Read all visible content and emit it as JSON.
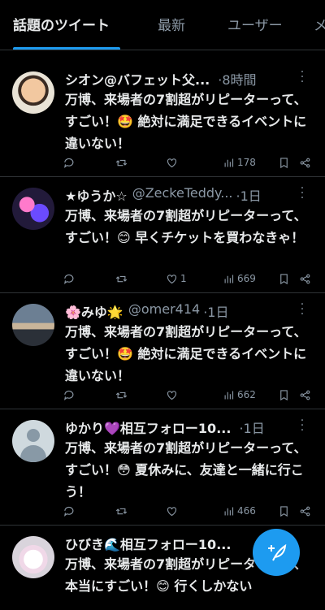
{
  "tabs": [
    {
      "label": "話題のツイート",
      "active": true
    },
    {
      "label": "最新",
      "active": false
    },
    {
      "label": "ユーザー",
      "active": false
    },
    {
      "label": "メ",
      "active": false
    }
  ],
  "tweets": [
    {
      "name": "シオン@バフェット父...",
      "handle": "",
      "time": "·8時間",
      "text": "万博、来場者の7割超がリピーターって、すごい！🤩 絶対に満足できるイベントに違いない！",
      "reply": "",
      "retweet": "",
      "like": "",
      "views": "178"
    },
    {
      "name": "★ゆうか☆",
      "handle": "@ZeckeTeddy...",
      "time": "·1日",
      "text": "万博、来場者の7割超がリピーターって、すごい！😊 早くチケットを買わなきゃ！",
      "reply": "",
      "retweet": "",
      "like": "1",
      "views": "669"
    },
    {
      "name": "🌸みゆ🌟",
      "handle": "@omer414",
      "time": "·1日",
      "text": "万博、来場者の7割超がリピーターって、すごい！🤩 絶対に満足できるイベントに違いない！",
      "reply": "",
      "retweet": "",
      "like": "",
      "views": "662"
    },
    {
      "name": "ゆかり💜相互フォロー10...",
      "handle": "",
      "time": "·1日",
      "text": "万博、来場者の7割超がリピーターって、すごい！😳 夏休みに、友達と一緒に行こう！",
      "reply": "",
      "retweet": "",
      "like": "",
      "views": "466"
    },
    {
      "name": "ひびき🌊相互フォロー10...",
      "handle": "",
      "time": "",
      "text": "万博、来場者の7割超がリピーターって、本当にすごい！😊 行くしかない",
      "reply": "",
      "retweet": "",
      "like": "",
      "views": ""
    }
  ],
  "accent_color": "#1d9bf0"
}
